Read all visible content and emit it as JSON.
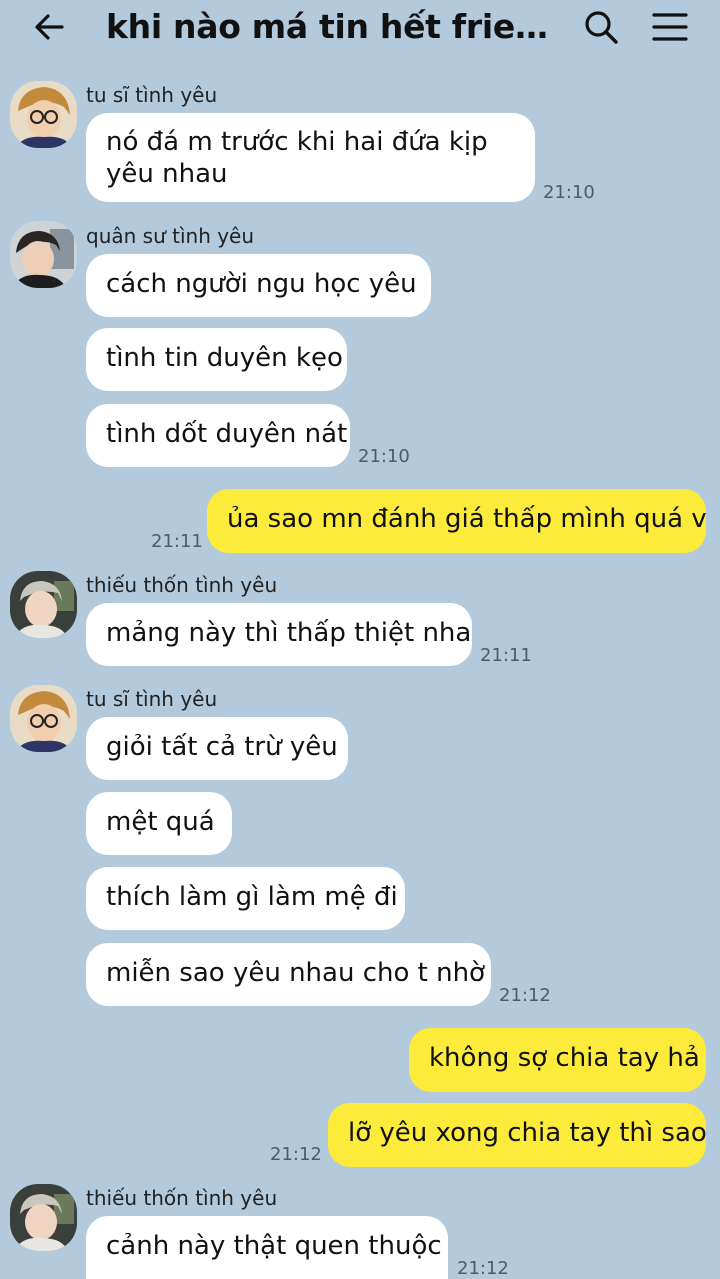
{
  "header": {
    "title": "khi nào má tin hết friendzo...",
    "back_icon": "back-arrow-icon",
    "search_icon": "search-icon",
    "menu_icon": "menu-icon"
  },
  "colors": {
    "background": "#b3c9dc",
    "incoming_bubble": "#ffffff",
    "outgoing_bubble": "#fdeb3c"
  },
  "messages": {
    "g1": {
      "sender": "tu sĩ tình yêu",
      "m1": "nó đá m trước khi hai đứa kịp yêu nhau",
      "time": "21:10"
    },
    "g2": {
      "sender": "quân sư tình yêu",
      "m1": "cách người ngu học yêu",
      "m2": "tình tin duyên kẹo",
      "m3": "tình dốt duyên nát",
      "time": "21:10"
    },
    "g3": {
      "m1": "ủa sao mn đánh giá thấp mình quá v",
      "time": "21:11"
    },
    "g4": {
      "sender": "thiếu thốn tình yêu",
      "m1": "mảng này thì thấp thiệt nha",
      "time": "21:11"
    },
    "g5": {
      "sender": "tu sĩ tình yêu",
      "m1": "giỏi tất cả trừ yêu",
      "m2": "mệt quá",
      "m3": "thích làm gì làm mệ đi",
      "m4": "miễn sao yêu nhau cho t nhờ",
      "time": "21:12"
    },
    "g6": {
      "m1": "không sợ chia tay hả",
      "m2": "lỡ yêu xong chia tay thì sao",
      "time": "21:12"
    },
    "g7": {
      "sender": "thiếu thốn tình yêu",
      "m1": "cảnh này thật quen thuộc",
      "time": "21:12"
    }
  }
}
